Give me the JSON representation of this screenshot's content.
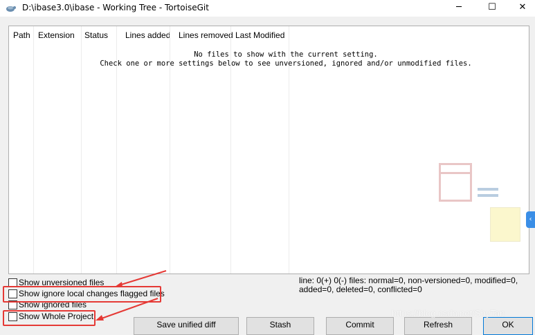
{
  "window": {
    "title": "D:\\ibase3.0\\ibase - Working Tree - TortoiseGit",
    "minimize_glyph": "─",
    "maximize_glyph": "☐",
    "close_glyph": "✕"
  },
  "file_list": {
    "columns": [
      "Path",
      "Extension",
      "Status",
      "Lines added",
      "Lines removed",
      "Last Modified"
    ],
    "empty_message_line1": "No files to show with the current setting.",
    "empty_message_line2": "Check one or more settings below to see unversioned, ignored and/or unmodified files."
  },
  "options": {
    "show_unversioned": {
      "label": "Show unversioned files",
      "checked": false
    },
    "show_ignore_local_changes": {
      "label": "Show ignore local changes flagged files",
      "checked": false
    },
    "show_ignored": {
      "label": "Show ignored files",
      "checked": false
    },
    "show_whole_project": {
      "label": "Show Whole Project",
      "checked": false
    }
  },
  "status": {
    "line1": "line: 0(+) 0(-) files: normal=0, non-versioned=0, modified=0,",
    "line2": "added=0, deleted=0, conflicted=0"
  },
  "buttons": {
    "save_unified_diff": "Save unified diff",
    "stash": "Stash",
    "commit": "Commit",
    "refresh": "Refresh",
    "ok": "OK"
  },
  "watermark": "https://blog.csdn.net/ShyTan",
  "colors": {
    "highlight": "#e53935",
    "window_bg": "#f0f0f0",
    "ok_border": "#0078d7"
  },
  "icons": {
    "app": "tortoisegit-icon",
    "side_tab": "expand-icon"
  }
}
